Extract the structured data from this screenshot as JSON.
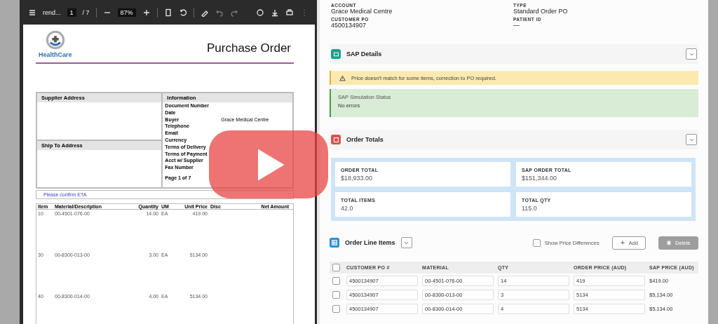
{
  "pdf_viewer": {
    "toolbar": {
      "filename": "rend...",
      "page": "1",
      "page_total": "/ 7",
      "zoom": "87%"
    },
    "document": {
      "logo_text": "HealthCare",
      "title": "Purchase Order",
      "supplier_heading": "Supplier Address",
      "ship_to_heading": "Ship To Address",
      "info_heading": "Information",
      "info_fields": [
        {
          "label": "Document Number"
        },
        {
          "label": "Date"
        },
        {
          "label": "Buyer",
          "value": "Grace Medical Centre"
        },
        {
          "label": "Telephone"
        },
        {
          "label": "Email"
        },
        {
          "label": "Currency"
        },
        {
          "label": "Terms of Delivery"
        },
        {
          "label": "Terms of Payment"
        },
        {
          "label": "Acct w/ Supplier"
        },
        {
          "label": "Fax Number"
        }
      ],
      "page_label": "Page 1 of 7",
      "note": "Please confirm ETA",
      "columns": [
        "Item",
        "Material/Description",
        "Quantity",
        "UM",
        "Unit Price",
        "Disc",
        "Net Amount"
      ],
      "rows": [
        {
          "item": "10",
          "material": "00-4501-076-00",
          "quantity": "14.00",
          "um": "EA",
          "unit_price": "419.00"
        },
        {
          "item": "30",
          "material": "00-8300-013-00",
          "quantity": "3.00",
          "um": "EA",
          "unit_price": "5134.00"
        },
        {
          "item": "40",
          "material": "00-8300-014-00",
          "quantity": "4.00",
          "um": "EA",
          "unit_price": "5134.00"
        }
      ]
    }
  },
  "header_fields": [
    {
      "label": "ACCOUNT",
      "value": "Grace Medical Centre"
    },
    {
      "label": "TYPE",
      "value": "Standard Order PO"
    },
    {
      "label": "CUSTOMER PO",
      "value": "4500134907"
    },
    {
      "label": "PATIENT ID",
      "value": "—"
    }
  ],
  "sap_details": {
    "title": "SAP Details",
    "warning": "Price doesn't match for some items, correction to PO required.",
    "status_title": "SAP Simulation Status",
    "status_text": "No errors"
  },
  "order_totals": {
    "title": "Order Totals",
    "cards": [
      {
        "label": "ORDER TOTAL",
        "value": "$18,933.00"
      },
      {
        "label": "SAP ORDER TOTAL",
        "value": "$151,344.00"
      },
      {
        "label": "TOTAL ITEMS",
        "value": "42.0"
      },
      {
        "label": "TOTAL QTY",
        "value": "115.0"
      }
    ]
  },
  "line_items": {
    "title": "Order Line Items",
    "all_selected": false,
    "show_price_differences": {
      "label": "Show Price Differences",
      "checked": false
    },
    "add_button": "Add",
    "delete_button": {
      "label": "Delete",
      "disabled": true
    },
    "columns": [
      "CUSTOMER PO #",
      "MATERIAL",
      "QTY",
      "ORDER PRICE (AUD)",
      "SAP PRICE (AUD)"
    ],
    "rows": [
      {
        "selected": false,
        "customer_po": "4500134907",
        "material": "00-4501-076-00",
        "qty": "14",
        "order_price": "419",
        "sap_price": "$419.00"
      },
      {
        "selected": false,
        "customer_po": "4500134907",
        "material": "00-8300-013-00",
        "qty": "3",
        "order_price": "5134",
        "sap_price": "$5,134.00"
      },
      {
        "selected": false,
        "customer_po": "4500134907",
        "material": "00-8300-014-00",
        "qty": "4",
        "order_price": "5134",
        "sap_price": "$5,134.00"
      }
    ]
  }
}
